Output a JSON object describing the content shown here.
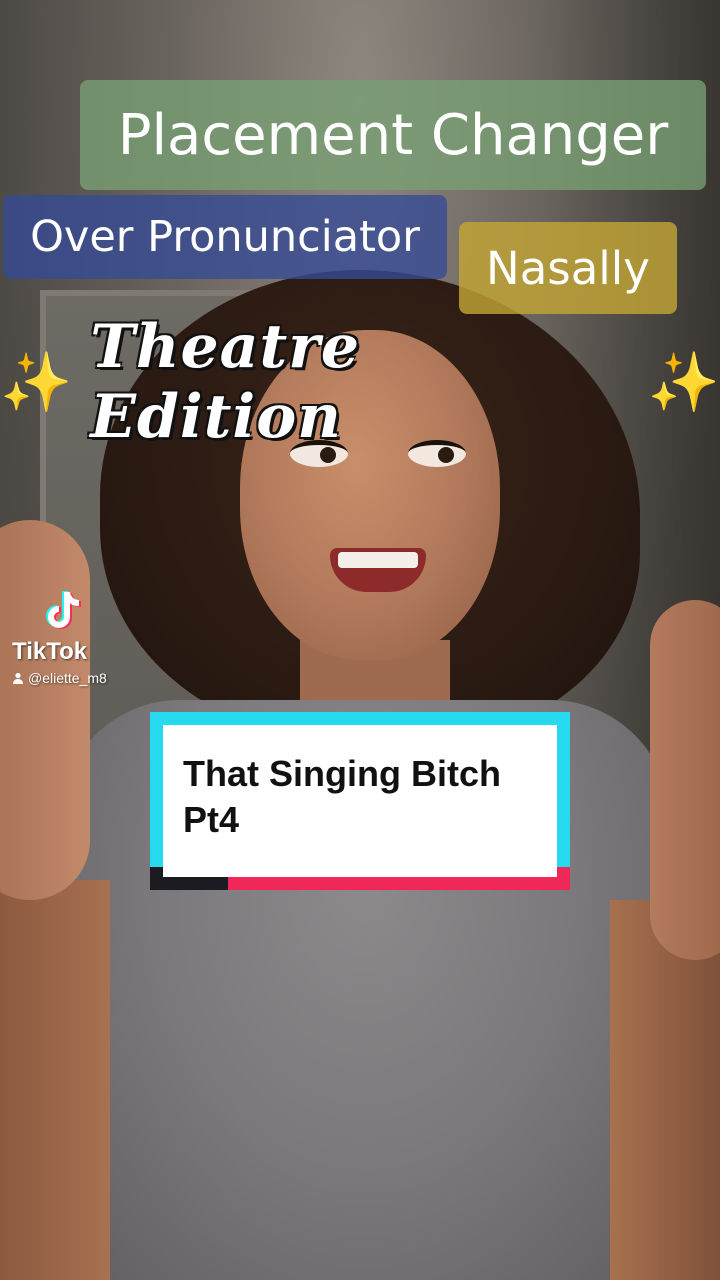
{
  "overlays": {
    "placement": "Placement Changer",
    "pronunciator": "Over Pronunciator",
    "nasally": "Nasally",
    "theatre": "Theatre Edition",
    "sparkle_glyph": "✨"
  },
  "watermark": {
    "brand": "TikTok",
    "username": "@eliette_m8",
    "logo_icon": "tiktok-note-icon",
    "user_icon": "person-icon"
  },
  "title_card": {
    "text": "That Singing Bitch\nPt4"
  },
  "colors": {
    "green_tag": "#78a073",
    "blue_tag": "#364a96",
    "yellow_tag": "#c4a634",
    "card_cyan": "#25d9ee",
    "card_red": "#f0285a",
    "sparkle": "#f4c83e"
  }
}
